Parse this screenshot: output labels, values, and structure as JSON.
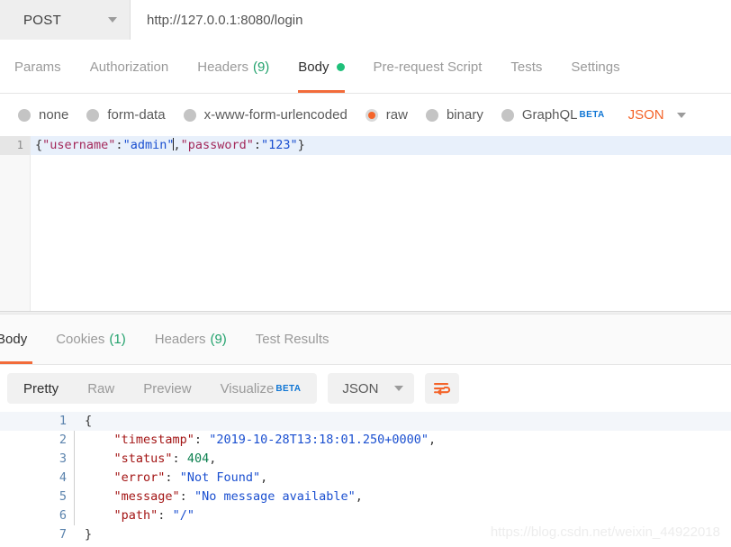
{
  "request": {
    "method": "POST",
    "url": "http://127.0.0.1:8080/login",
    "tabs": [
      {
        "label": "Params",
        "count": "",
        "active": false
      },
      {
        "label": "Authorization",
        "count": "",
        "active": false
      },
      {
        "label": "Headers",
        "count": "(9)",
        "active": false
      },
      {
        "label": "Body",
        "count": "",
        "active": true
      },
      {
        "label": "Pre-request Script",
        "count": "",
        "active": false
      },
      {
        "label": "Tests",
        "count": "",
        "active": false
      },
      {
        "label": "Settings",
        "count": "",
        "active": false
      }
    ],
    "body_types": [
      {
        "label": "none",
        "selected": false
      },
      {
        "label": "form-data",
        "selected": false
      },
      {
        "label": "x-www-form-urlencoded",
        "selected": false
      },
      {
        "label": "raw",
        "selected": true
      },
      {
        "label": "binary",
        "selected": false
      },
      {
        "label": "GraphQL",
        "selected": false,
        "badge": "BETA"
      }
    ],
    "raw_format": "JSON",
    "editor": {
      "line_number": "1",
      "tokens": {
        "brace_open": "{",
        "key_username": "\"username\"",
        "colon1": ":",
        "val_admin": "\"admin\"",
        "comma": ",",
        "key_password": "\"password\"",
        "colon2": ":",
        "val_123": "\"123\"",
        "brace_close": "}"
      }
    }
  },
  "response": {
    "tabs": [
      {
        "label": "Body",
        "count": "",
        "active": true
      },
      {
        "label": "Cookies",
        "count": "(1)",
        "active": false
      },
      {
        "label": "Headers",
        "count": "(9)",
        "active": false
      },
      {
        "label": "Test Results",
        "count": "",
        "active": false
      }
    ],
    "view_modes": [
      {
        "label": "Pretty",
        "active": true
      },
      {
        "label": "Raw",
        "active": false
      },
      {
        "label": "Preview",
        "active": false
      },
      {
        "label": "Visualize",
        "active": false,
        "badge": "BETA"
      }
    ],
    "format": "JSON",
    "wrap_icon": "word-wrap-icon",
    "lines": [
      {
        "n": "1",
        "hl": true,
        "fold": false,
        "indent": "",
        "key": "",
        "sep": "",
        "value": "",
        "value_type": "punc",
        "tail": "{"
      },
      {
        "n": "2",
        "hl": false,
        "fold": true,
        "indent": "    ",
        "key": "\"timestamp\"",
        "sep": ": ",
        "value": "\"2019-10-28T13:18:01.250+0000\"",
        "value_type": "string",
        "tail": ","
      },
      {
        "n": "3",
        "hl": false,
        "fold": true,
        "indent": "    ",
        "key": "\"status\"",
        "sep": ": ",
        "value": "404",
        "value_type": "number",
        "tail": ","
      },
      {
        "n": "4",
        "hl": false,
        "fold": true,
        "indent": "    ",
        "key": "\"error\"",
        "sep": ": ",
        "value": "\"Not Found\"",
        "value_type": "string",
        "tail": ","
      },
      {
        "n": "5",
        "hl": false,
        "fold": true,
        "indent": "    ",
        "key": "\"message\"",
        "sep": ": ",
        "value": "\"No message available\"",
        "value_type": "string",
        "tail": ","
      },
      {
        "n": "6",
        "hl": false,
        "fold": true,
        "indent": "    ",
        "key": "\"path\"",
        "sep": ": ",
        "value": "\"/\"",
        "value_type": "string",
        "tail": ""
      },
      {
        "n": "7",
        "hl": false,
        "fold": false,
        "indent": "",
        "key": "",
        "sep": "",
        "value": "",
        "value_type": "punc",
        "tail": "}"
      }
    ]
  },
  "watermark": "https://blog.csdn.net/weixin_44922018",
  "colors": {
    "accent_orange": "#f26b3a",
    "badge_blue": "#1076d4",
    "count_green": "#23a26d",
    "dot_green": "#1fc07a",
    "json_key": "#a31515",
    "json_string": "#1a4fd0",
    "json_number": "#0d8050"
  }
}
